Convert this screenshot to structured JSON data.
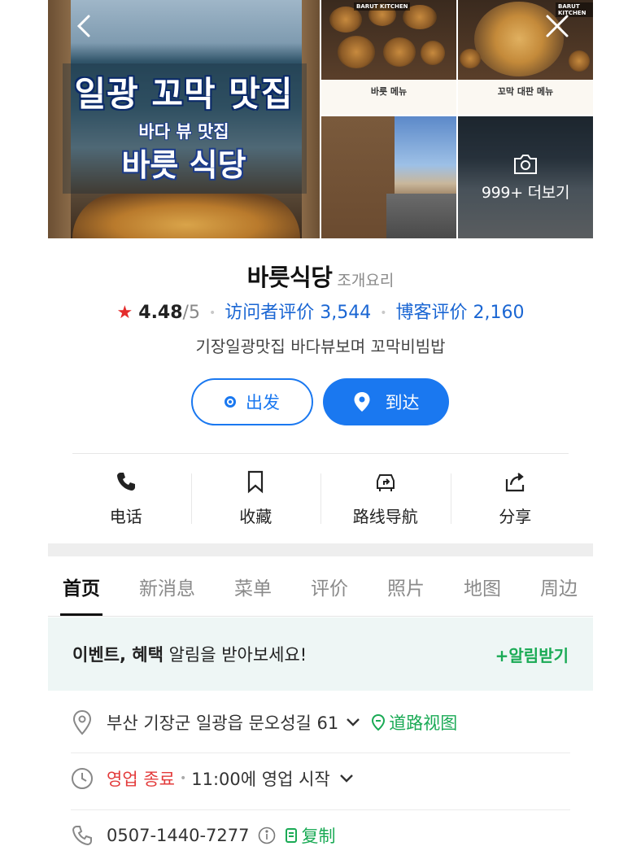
{
  "gallery": {
    "main_line1": "일광 꼬막 맛집",
    "main_line2": "바다 뷰 맛집",
    "main_line3": "바릇 식당",
    "brand_a": "BARUT KITCHEN",
    "brand_b": "BARUT KITCHEN",
    "menu_a_title": "바릇 메뉴",
    "menu_b_title": "꼬막 대판 메뉴",
    "more_label": "999+ 더보기",
    "back_icon": "chevron-left-icon",
    "close_icon": "close-icon",
    "camera_icon": "camera-icon"
  },
  "place": {
    "name": "바릇식당",
    "category": "조개요리",
    "rating": "4.48",
    "rating_scale": "/5",
    "visitor_reviews": "访问者评价 3,544",
    "blog_reviews": "博客评价 2,160",
    "description": "기장일광맛집 바다뷰보며 꼬막비빔밥"
  },
  "buttons": {
    "depart": "出发",
    "arrive": "到达"
  },
  "actions": [
    {
      "label": "电话",
      "icon": "phone-icon"
    },
    {
      "label": "收藏",
      "icon": "bookmark-icon"
    },
    {
      "label": "路线导航",
      "icon": "car-navigation-icon"
    },
    {
      "label": "分享",
      "icon": "share-icon"
    }
  ],
  "tabs": [
    "首页",
    "新消息",
    "菜单",
    "评价",
    "照片",
    "地图",
    "周边"
  ],
  "alert": {
    "bold": "이벤트, 혜택",
    "text": " 알림을 받아보세요!",
    "action": "+알림받기"
  },
  "info": {
    "address": "부산 기장군 일광읍 문오성길 61",
    "street_view": "道路视图",
    "status": "영업 종료",
    "hours": "11:00에 영업 시작",
    "phone": "0507-1440-7277",
    "copy": "复制"
  },
  "colors": {
    "accent": "#1a78f0",
    "link_blue": "#1a66d3",
    "green": "#1aaa55",
    "red": "#e33b3b",
    "star": "#e42b2b"
  }
}
